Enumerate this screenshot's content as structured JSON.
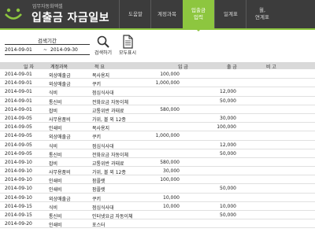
{
  "header": {
    "subtitle": "업무자동화엑셀",
    "title": "입출금 자금일보",
    "nav": [
      {
        "label": "도움말",
        "active": false
      },
      {
        "label": "계정과목",
        "active": false
      },
      {
        "label": "입출금\n입력",
        "active": true
      },
      {
        "label": "일계표",
        "active": false
      },
      {
        "label": "월,\n연계표",
        "active": false
      }
    ]
  },
  "search": {
    "period_label": "검색기간",
    "from_date": "2014-09-01",
    "tilde": "~",
    "to_date": "2014-09-30",
    "search_button": "검색하기",
    "show_all_button": "모두표시"
  },
  "table": {
    "columns": [
      "일 자",
      "계정과목",
      "적 요",
      "입 금",
      "출 금",
      "비 고"
    ],
    "rows": [
      {
        "date": "2014-09-01",
        "account": "외상매출금",
        "memo": "복사용지",
        "deposit": "100,000",
        "withdrawal": ""
      },
      {
        "date": "2014-09-01",
        "account": "외상매출금",
        "memo": "쿠키",
        "deposit": "1,000,000",
        "withdrawal": ""
      },
      {
        "date": "2014-09-01",
        "account": "식비",
        "memo": "점심식사대",
        "deposit": "",
        "withdrawal": "12,000"
      },
      {
        "date": "2014-09-01",
        "account": "통신비",
        "memo": "전화요금 자동이체",
        "deposit": "",
        "withdrawal": "50,000"
      },
      {
        "date": "2014-09-01",
        "account": "잡비",
        "memo": "교통위반 과태료",
        "deposit": "580,000",
        "withdrawal": ""
      },
      {
        "date": "2014-09-05",
        "account": "사무용품비",
        "memo": "가위, 볼 외 12종",
        "deposit": "",
        "withdrawal": "30,000"
      },
      {
        "date": "2014-09-05",
        "account": "인쇄비",
        "memo": "복사용지",
        "deposit": "",
        "withdrawal": "100,000"
      },
      {
        "date": "2014-09-05",
        "account": "외상매출금",
        "memo": "쿠키",
        "deposit": "1,000,000",
        "withdrawal": ""
      },
      {
        "date": "2014-09-05",
        "account": "식비",
        "memo": "점심식사대",
        "deposit": "",
        "withdrawal": "12,000"
      },
      {
        "date": "2014-09-05",
        "account": "통신비",
        "memo": "전화요금 자동이체",
        "deposit": "",
        "withdrawal": "50,000"
      },
      {
        "date": "2014-09-10",
        "account": "잡비",
        "memo": "교통위반 과태료",
        "deposit": "580,000",
        "withdrawal": ""
      },
      {
        "date": "2014-09-10",
        "account": "사무용품비",
        "memo": "가위, 볼 외 12종",
        "deposit": "30,000",
        "withdrawal": ""
      },
      {
        "date": "2014-09-10",
        "account": "인쇄비",
        "memo": "팜플렛",
        "deposit": "100,000",
        "withdrawal": ""
      },
      {
        "date": "2014-09-10",
        "account": "인쇄비",
        "memo": "팜플렛",
        "deposit": "",
        "withdrawal": "50,000"
      },
      {
        "date": "2014-09-10",
        "account": "외상매출금",
        "memo": "쿠키",
        "deposit": "10,000",
        "withdrawal": ""
      },
      {
        "date": "2014-09-15",
        "account": "식비",
        "memo": "점심식사대",
        "deposit": "10,000",
        "withdrawal": "10,000"
      },
      {
        "date": "2014-09-15",
        "account": "통신비",
        "memo": "인터넷요금 자동이체",
        "deposit": "",
        "withdrawal": "50,000"
      },
      {
        "date": "2014-09-20",
        "account": "인쇄비",
        "memo": "포스터",
        "deposit": "",
        "withdrawal": ""
      }
    ]
  },
  "colors": {
    "accent": "#8dc63f",
    "topbar": "#3c3c3c",
    "header_row": "#d9d9d9"
  },
  "icons": {
    "logo": "smile-logo-icon",
    "search": "magnifier-icon",
    "show_all": "document-icon"
  }
}
